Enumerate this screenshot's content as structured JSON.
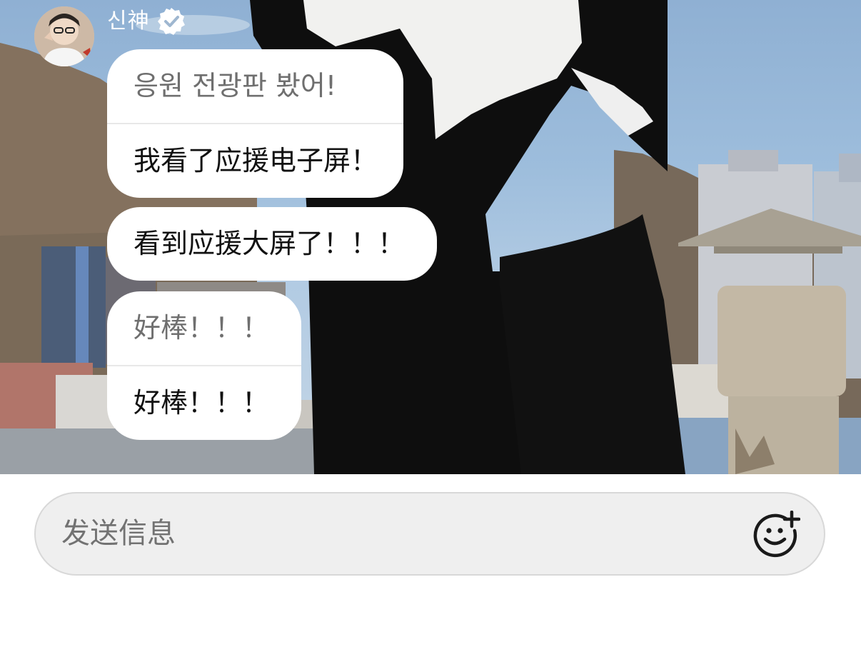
{
  "header": {
    "username": "신神",
    "avatar_icon": "profile-avatar",
    "verified_icon": "verified-badge-icon"
  },
  "messages": [
    {
      "original": "응원 전광판 봤어!",
      "translation": "我看了应援电子屏！"
    },
    {
      "text": "看到应援大屏了！！！"
    },
    {
      "original": "好棒！！！",
      "translation": "好棒！！！"
    }
  ],
  "input": {
    "placeholder": "发送信息",
    "emoji_icon": "add-emoji-icon"
  }
}
